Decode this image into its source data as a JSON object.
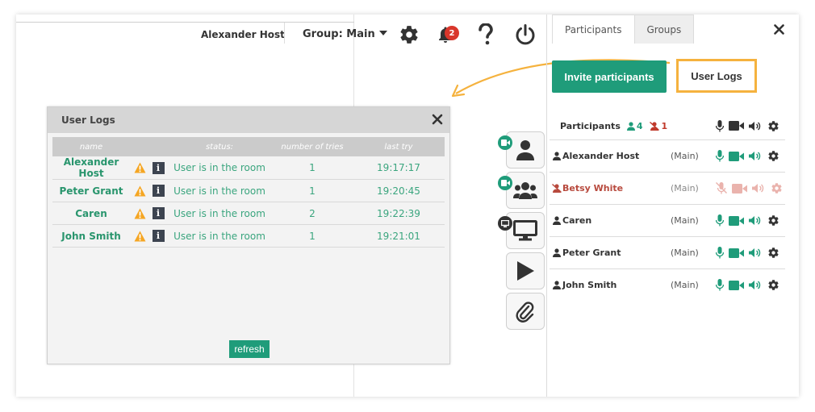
{
  "header": {
    "host_name": "Alexander Host",
    "group_label": "Group: Main",
    "notifications_count": "2"
  },
  "colors": {
    "accent": "#1f9c7a",
    "highlight": "#f5b23e",
    "danger": "#d9362b"
  },
  "dialog": {
    "title": "User Logs",
    "columns": [
      "name",
      "status:",
      "number of tries",
      "last try"
    ],
    "rows": [
      {
        "name": "Alexander Host",
        "status": "User is in the room",
        "tries": "1",
        "last_try": "19:17:17"
      },
      {
        "name": "Peter Grant",
        "status": "User is in the room",
        "tries": "1",
        "last_try": "19:20:45"
      },
      {
        "name": "Caren",
        "status": "User is in the room",
        "tries": "2",
        "last_try": "19:22:39"
      },
      {
        "name": "John Smith",
        "status": "User is in the room",
        "tries": "1",
        "last_try": "19:21:01"
      }
    ],
    "refresh_label": "refresh"
  },
  "panel": {
    "tabs": [
      "Participants",
      "Groups"
    ],
    "invite_label": "Invite participants",
    "userlogs_label": "User Logs",
    "participants_label": "Participants",
    "active_count": "4",
    "muted_count": "1",
    "participants": [
      {
        "name": "Alexander Host",
        "group": "(Main)",
        "muted": false
      },
      {
        "name": "Betsy White",
        "group": "(Main)",
        "muted": true
      },
      {
        "name": "Caren",
        "group": "(Main)",
        "muted": false
      },
      {
        "name": "Peter Grant",
        "group": "(Main)",
        "muted": false
      },
      {
        "name": "John Smith",
        "group": "(Main)",
        "muted": false
      }
    ]
  },
  "media_toolbar": [
    "user-icon",
    "group-icon",
    "screen-share-icon",
    "play-icon",
    "paperclip-icon"
  ]
}
